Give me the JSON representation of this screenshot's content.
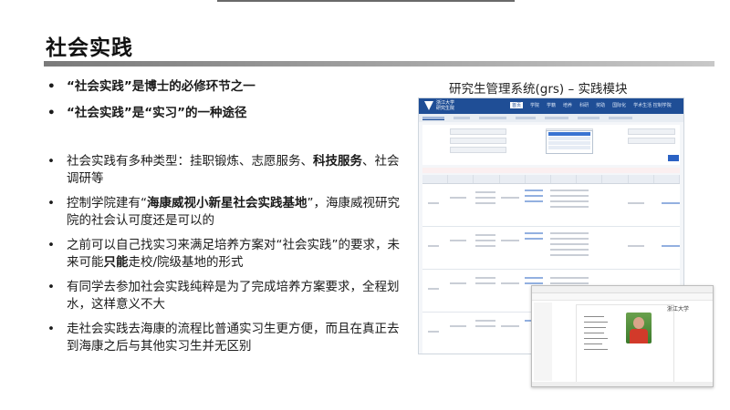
{
  "slide": {
    "title": "社会实践",
    "bullets_top": [
      "“社会实践”是博士的必修环节之一",
      "“社会实践”是“实习”的一种途径"
    ],
    "bullets_main": [
      {
        "pre": "社会实践有多种类型：挂职锻炼、志愿服务、",
        "bold": "科技服务",
        "post": "、社会调研等"
      },
      {
        "pre": "控制学院建有“",
        "bold": "海康威视小新星社会实践基地",
        "post": "”，海康威视研究院的社会认可度还是可以的"
      },
      {
        "pre": "之前可以自己找实习来满足培养方案对“社会实践”的要求，未来可能",
        "bold": "只能",
        "post": "走校/院级基地的形式"
      },
      {
        "pre": "有同学去参加社会实践纯粹是为了完成培养方案要求，全程划水，这样意义不大",
        "bold": "",
        "post": ""
      },
      {
        "pre": "走社会实践去海康的流程比普通实习生更方便，而且在真正去到海康之后与其他实习生并无区别",
        "bold": "",
        "post": ""
      }
    ],
    "bullet_symbol": "•",
    "system_caption": "研究生管理系统(grs) – 实践模块"
  },
  "screenshot": {
    "logo_line1": "浙江大学",
    "logo_line2": "研究生院",
    "nav": [
      "首页",
      "学院",
      "学籍",
      "培养",
      "科研",
      "奖助",
      "国际化"
    ],
    "active_nav": "首页",
    "user": "学术生活 控制学院"
  },
  "certificate": {
    "brand": "浙江大学"
  },
  "colors": {
    "grs_header": "#1f4e96",
    "title_bar": "#7a7a7a"
  }
}
